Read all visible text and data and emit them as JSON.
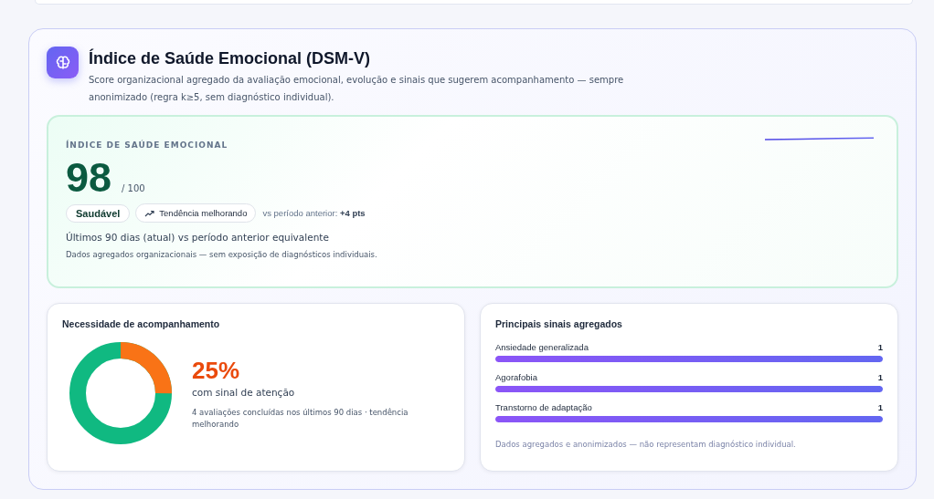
{
  "header": {
    "title": "Índice de Saúde Emocional (DSM-V)",
    "description": "Score organizacional agregado da avaliação emocional, evolução e sinais que sugerem acompanhamento — sempre anonimizado (regra k≥5, sem diagnóstico individual)."
  },
  "score_card": {
    "eyebrow": "ÍNDICE DE SAÚDE EMOCIONAL",
    "score": "98",
    "scale": "/ 100",
    "status": "Saudável",
    "trend": "Tendência melhorando",
    "comparison": "vs período anterior: **+4 pts**",
    "period": "Últimos 90 dias (atual) vs período anterior equivalente",
    "note": "Dados agregados organizacionais — sem exposição de diagnósticos individuais."
  },
  "follow_up": {
    "title": "Necessidade de acompanhamento",
    "level": 0.25,
    "percent": "25%",
    "caption": "com sinal de atenção",
    "detail": "4 avaliações concluídas nos últimos 90 dias · tendência melhorando"
  },
  "signals": {
    "title": "Principais sinais agregados",
    "items": [
      {
        "label": "Ansiedade generalizada",
        "count": "1",
        "level": 1
      },
      {
        "label": "Agorafobia",
        "count": "1",
        "level": 1
      },
      {
        "label": "Transtorno de adaptação",
        "count": "1",
        "level": 1
      }
    ],
    "note": "Dados agregados e anonimizados — não representam diagnóstico individual."
  }
}
